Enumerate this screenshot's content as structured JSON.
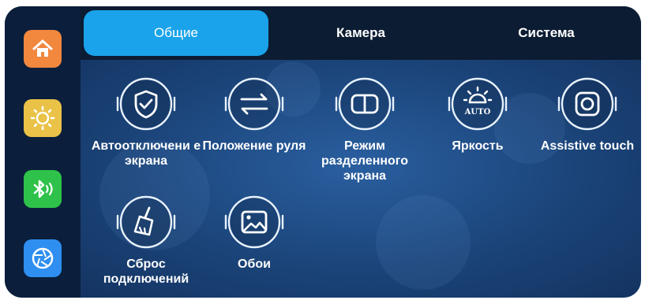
{
  "sidebar": {
    "items": [
      {
        "icon": "home-icon",
        "color": "#f2873e"
      },
      {
        "icon": "brightness-icon",
        "color": "#eac248"
      },
      {
        "icon": "bluetooth-audio-icon",
        "color": "#2fc24a"
      },
      {
        "icon": "camera-shutter-icon",
        "color": "#2e8ff0"
      }
    ]
  },
  "tabs": [
    {
      "label": "Общие",
      "active": true
    },
    {
      "label": "Камера",
      "active": false
    },
    {
      "label": "Система",
      "active": false
    }
  ],
  "tiles": [
    {
      "label": "Автоотключени е экрана",
      "icon": "shield-check-icon"
    },
    {
      "label": "Положение руля",
      "icon": "swap-arrows-icon"
    },
    {
      "label": "Режим разделенного экрана",
      "icon": "split-screen-icon"
    },
    {
      "label": "Яркость",
      "icon": "auto-brightness-icon",
      "badge": "AUTO"
    },
    {
      "label": "Assistive touch",
      "icon": "assistive-touch-icon"
    },
    {
      "label": "Сброс подключений",
      "icon": "broom-icon"
    },
    {
      "label": "Обои",
      "icon": "wallpaper-icon"
    }
  ],
  "colors": {
    "accent": "#1aa3ea",
    "background": "#1b4479",
    "tabbar": "#0c1c33"
  }
}
